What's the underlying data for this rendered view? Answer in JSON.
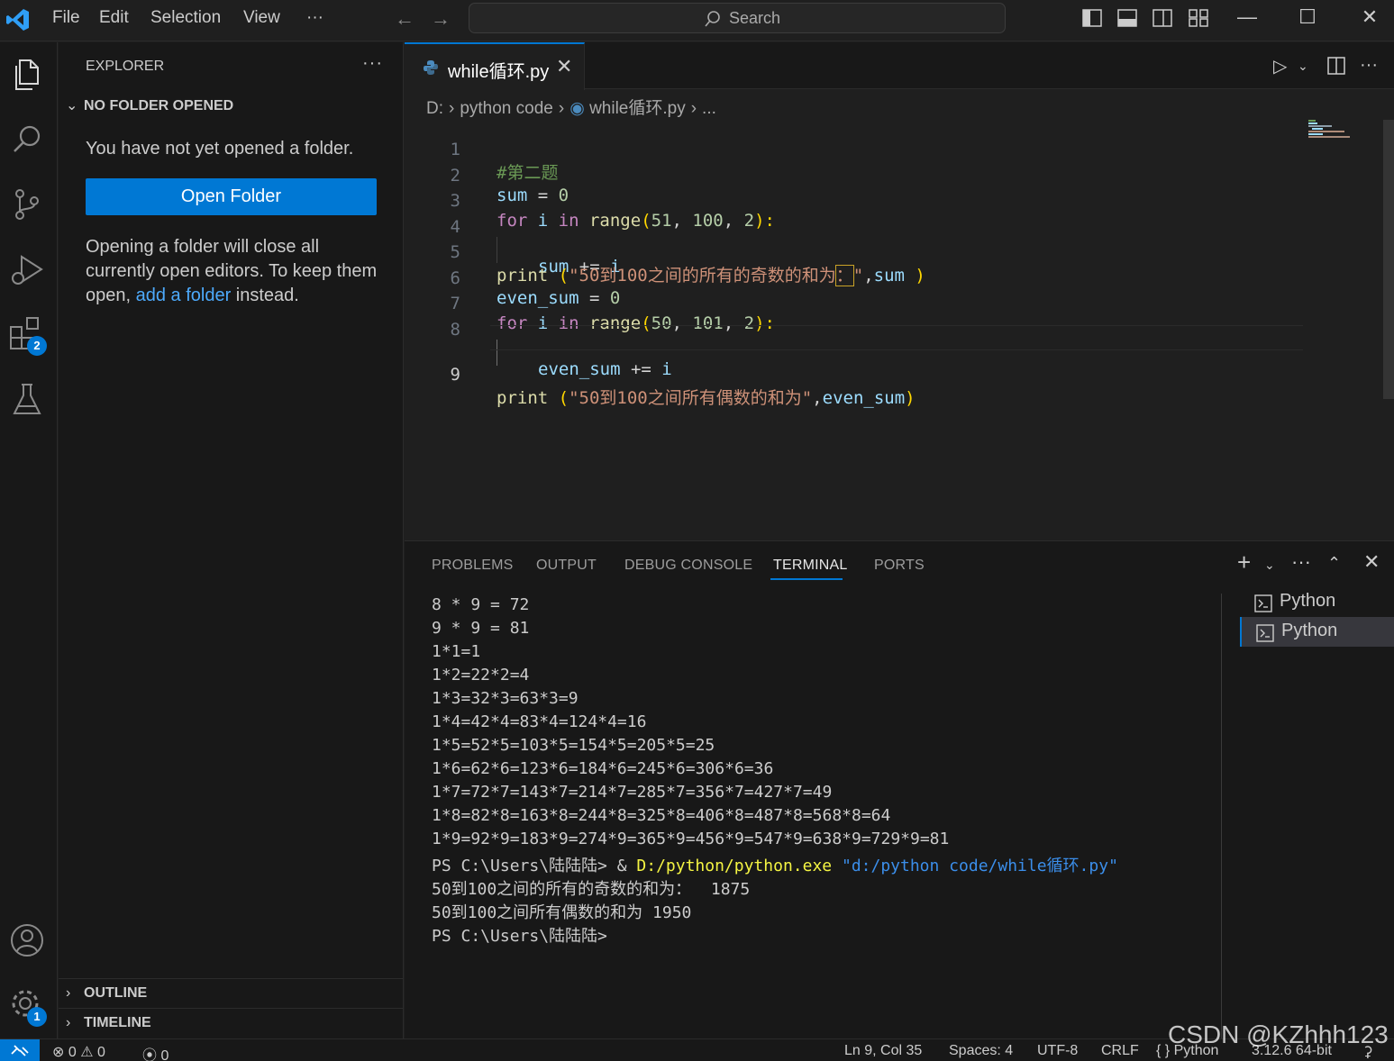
{
  "titlebar": {
    "menu": [
      "File",
      "Edit",
      "Selection",
      "View",
      "···"
    ],
    "search_placeholder": "Search"
  },
  "activitybar": {
    "extensions_badge": "2",
    "settings_badge": "1"
  },
  "sidebar": {
    "title": "EXPLORER",
    "more": "···",
    "section_no_folder": "NO FOLDER OPENED",
    "message": "You have not yet opened a folder.",
    "open_folder_label": "Open Folder",
    "info_line1": "Opening a folder will close all",
    "info_line2": "currently open editors. To keep them",
    "info_line3_pre": "open, ",
    "info_link": "add a folder",
    "info_line3_post": " instead.",
    "outline": "OUTLINE",
    "timeline": "TIMELINE"
  },
  "editor": {
    "tab_name": "while循环.py",
    "breadcrumb": {
      "drive": "D:",
      "folder": "python code",
      "file": "while循环.py",
      "tail": "..."
    },
    "line_numbers": [
      "1",
      "2",
      "3",
      "4",
      "5",
      "6",
      "7",
      "8",
      "9"
    ],
    "code": {
      "l1": "#第二题",
      "l2_var": "sum",
      "l2_op": " = ",
      "l2_num": "0",
      "l3_for": "for",
      "l3_i": " i ",
      "l3_in": "in",
      "l3_range": " range",
      "l3_paren_open": "(",
      "l3_a": "51",
      "l3_b": "100",
      "l3_c": "2",
      "l3_comma": ", ",
      "l3_close": "):",
      "l4_var": "sum",
      "l4_op": " += ",
      "l4_i": "i",
      "l5_print": "print",
      "l5_paren": " (",
      "l5_str_a": "\"50到100之间的所有的奇数的和为",
      "l5_str_colon": "：",
      "l5_str_b": "\"",
      "l5_comma": ",",
      "l5_sum": "sum",
      "l5_close": " )",
      "l6_var": "even_sum",
      "l6_op": " = ",
      "l6_num": "0",
      "l7_a": "50",
      "l7_b": "101",
      "l7_c": "2",
      "l8_var": "even_sum",
      "l8_op": " += ",
      "l8_i": "i",
      "l9_str": "\"50到100之间所有偶数的和为\"",
      "l9_comma": ",",
      "l9_var": "even_sum",
      "l9_close": ")"
    }
  },
  "panel": {
    "tabs": [
      "PROBLEMS",
      "OUTPUT",
      "DEBUG CONSOLE",
      "TERMINAL",
      "PORTS"
    ],
    "active_tab": "TERMINAL",
    "terminal_lines": [
      "8 * 9 = 72",
      "9 * 9 = 81",
      "1*1=1",
      "1*2=22*2=4",
      "1*3=32*3=63*3=9",
      "1*4=42*4=83*4=124*4=16",
      "1*5=52*5=103*5=154*5=205*5=25",
      "1*6=62*6=123*6=184*6=245*6=306*6=36",
      "1*7=72*7=143*7=214*7=285*7=356*7=427*7=49",
      "1*8=82*8=163*8=244*8=325*8=406*8=487*8=568*8=64",
      "1*9=92*9=183*9=274*9=365*9=456*9=547*9=638*9=729*9=81"
    ],
    "cmd_prompt": "PS C:\\Users\\陆陆陆> & ",
    "cmd_exe": "D:/python/python.exe",
    "cmd_arg": " \"d:/python code/while循环.py\"",
    "out1": "50到100之间的所有的奇数的和为：  1875",
    "out2": "50到100之间所有偶数的和为 1950",
    "prompt_end": "PS C:\\Users\\陆陆陆>",
    "terminals": [
      "Python",
      "Python"
    ]
  },
  "statusbar": {
    "errors": "0",
    "warnings": "0",
    "ports": "0",
    "position": "Ln 9, Col 35",
    "spaces": "Spaces: 4",
    "encoding": "UTF-8",
    "eol": "CRLF",
    "language_braces": "{ }",
    "language": "Python",
    "interpreter": "3.12.6 64-bit"
  },
  "watermark": "CSDN @KZhhh123"
}
